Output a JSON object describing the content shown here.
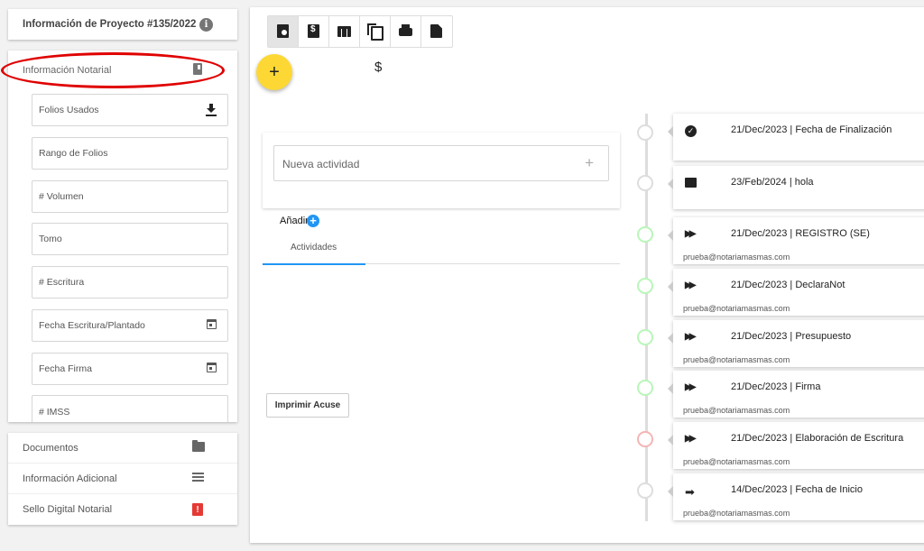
{
  "project": {
    "title": "Información de Proyecto #135/2022",
    "info_icon": "i"
  },
  "notarial": {
    "title": "Información Notarial",
    "fields": [
      {
        "label": "Folios Usados",
        "icon": "download-icon"
      },
      {
        "label": "Rango de Folios"
      },
      {
        "label": "# Volumen"
      },
      {
        "label": "Tomo"
      },
      {
        "label": "# Escritura"
      },
      {
        "label": "Fecha Escritura/Plantado",
        "icon": "calendar-icon"
      },
      {
        "label": "Fecha Firma",
        "icon": "calendar-icon"
      },
      {
        "label": "# IMSS"
      }
    ]
  },
  "sections": [
    {
      "label": "Documentos",
      "icon": "folder-icon"
    },
    {
      "label": "Información Adicional",
      "icon": "list-icon"
    },
    {
      "label": "Sello Digital Notarial",
      "icon": "clipboard-alert-icon"
    }
  ],
  "toolbar": {
    "buttons": [
      "clipboard-clock-icon",
      "dollar-file-icon",
      "table-icon",
      "copy-icon",
      "print-icon",
      "file-icon"
    ],
    "fab": "+",
    "dollar": "$"
  },
  "activity": {
    "placeholder": "Nueva actividad",
    "plus": "+",
    "add_label": "Añadir",
    "add_icon": "+",
    "tab": "Actividades",
    "print_button": "Imprimir Acuse"
  },
  "timeline": [
    {
      "text": "21/Dec/2023 | Fecha de Finalización",
      "icon": "check-circle-icon",
      "email": "",
      "ring": "#dddddd"
    },
    {
      "text": "23/Feb/2024 | hola",
      "icon": "chat-icon",
      "email": "",
      "ring": "#dddddd"
    },
    {
      "text": "21/Dec/2023 | REGISTRO (SE)",
      "icon": "fast-forward-icon",
      "email": "prueba@notariamasmas.com",
      "ring": "#b9f6b9"
    },
    {
      "text": "21/Dec/2023 | DeclaraNot",
      "icon": "fast-forward-icon",
      "email": "prueba@notariamasmas.com",
      "ring": "#b9f6b9"
    },
    {
      "text": "21/Dec/2023 | Presupuesto",
      "icon": "fast-forward-icon",
      "email": "prueba@notariamasmas.com",
      "ring": "#b9f6b9"
    },
    {
      "text": "21/Dec/2023 | Firma",
      "icon": "fast-forward-icon",
      "email": "prueba@notariamasmas.com",
      "ring": "#b9f6b9"
    },
    {
      "text": "21/Dec/2023 | Elaboración de Escritura",
      "icon": "fast-forward-icon",
      "email": "prueba@notariamasmas.com",
      "ring": "#f5b5b5"
    },
    {
      "text": "14/Dec/2023 | Fecha de Inicio",
      "icon": "arrow-right-icon",
      "email": "prueba@notariamasmas.com",
      "ring": "#dddddd"
    }
  ],
  "colors": {
    "fab": "#fdd835",
    "accent": "#2196f3",
    "highlight": "#e00000"
  }
}
